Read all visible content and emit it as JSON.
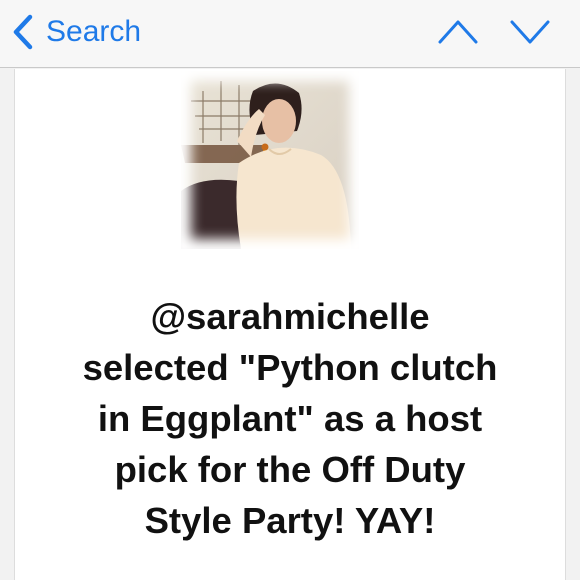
{
  "nav": {
    "back_label": "Search",
    "back_icon": "chevron-left-icon",
    "prev_icon": "chevron-up-icon",
    "next_icon": "chevron-down-icon",
    "accent_color": "#1f7ae8"
  },
  "post": {
    "photo_icon": "profile-photo",
    "message_lines": [
      "@sarahmichelle",
      "selected \"Python clutch",
      "in Eggplant\" as a host",
      "pick for the Off Duty",
      "Style Party! YAY!"
    ]
  }
}
